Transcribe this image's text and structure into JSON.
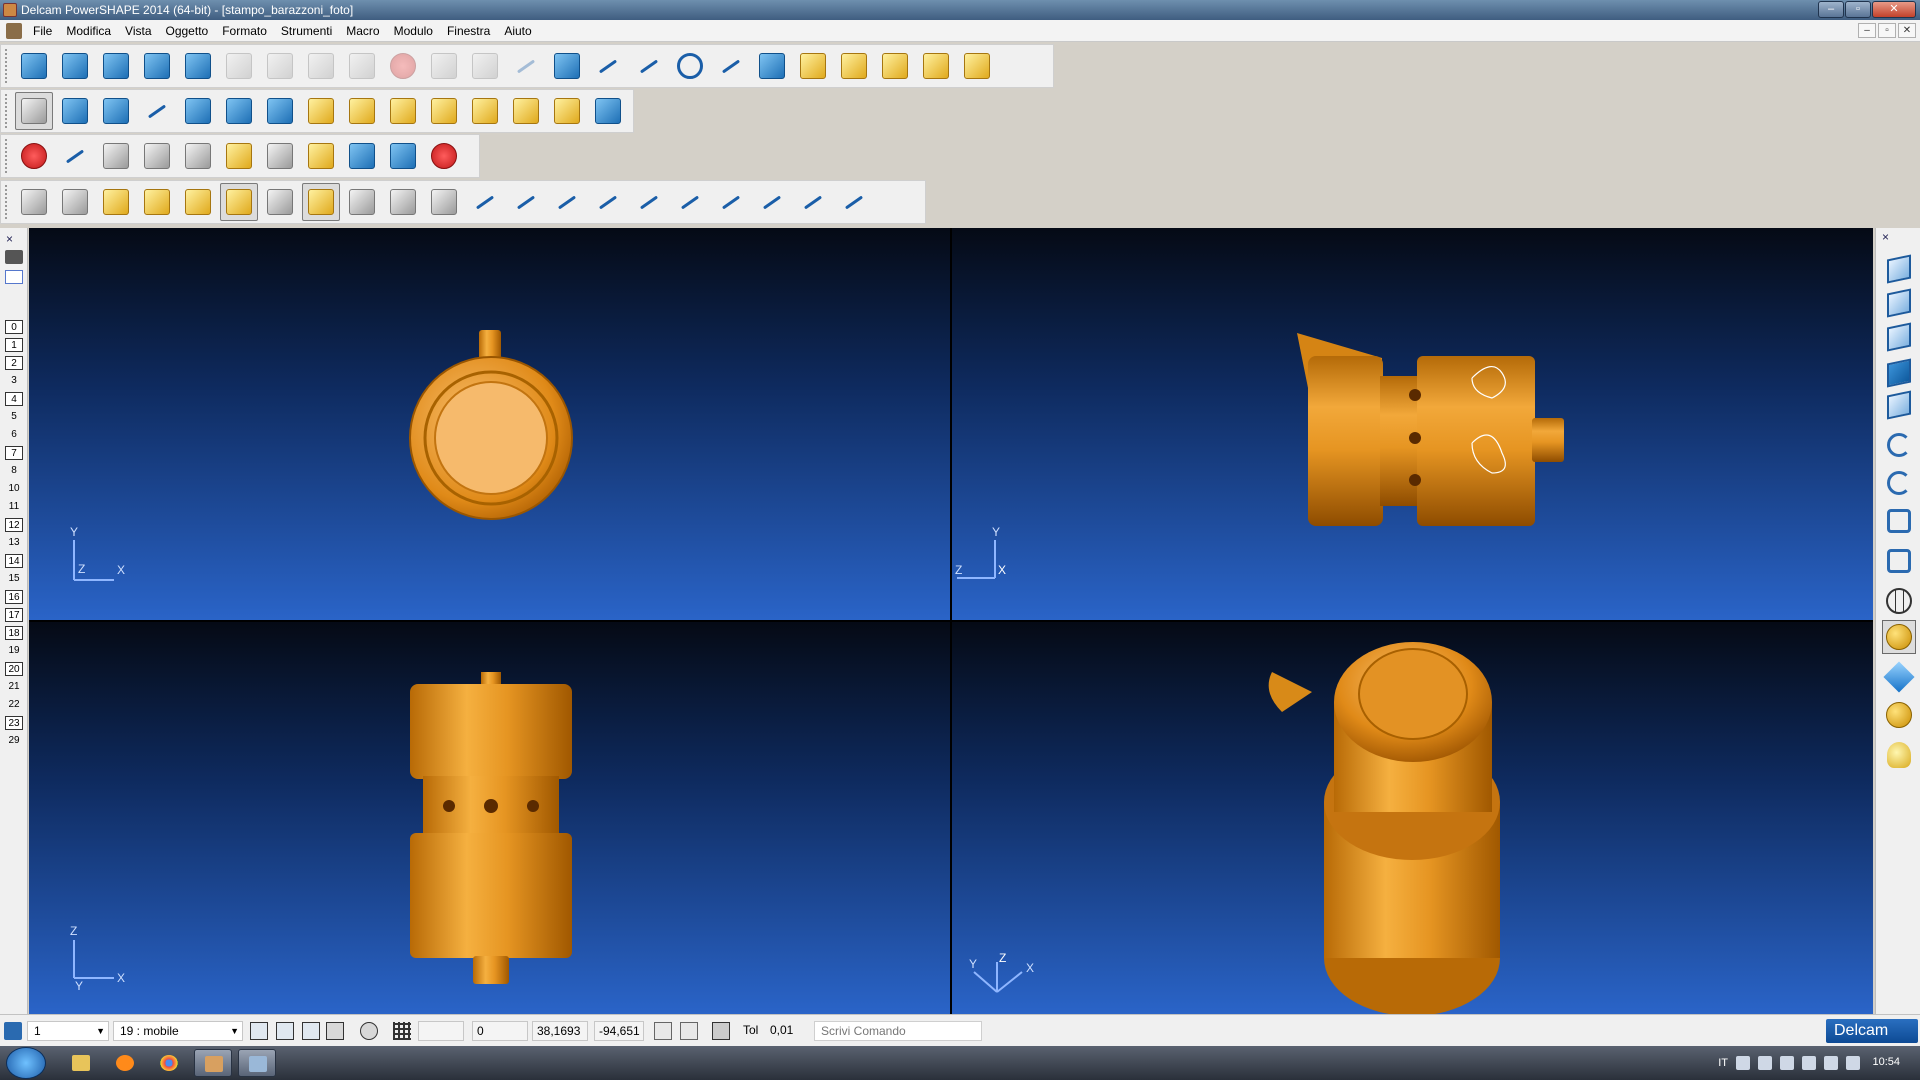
{
  "window": {
    "title": "Delcam PowerSHAPE 2014 (64-bit) - [stampo_barazzoni_foto]",
    "buttons": [
      "–",
      "▫",
      "✕"
    ]
  },
  "menu": {
    "items": [
      "File",
      "Modifica",
      "Vista",
      "Oggetto",
      "Formato",
      "Strumenti",
      "Macro",
      "Modulo",
      "Finestra",
      "Aiuto"
    ],
    "mdi_buttons": [
      "–",
      "▫",
      "✕"
    ]
  },
  "toolbar1": {
    "icons": [
      "new-file-icon",
      "open-folder-icon",
      "import-icon",
      "save-icon",
      "print-icon",
      "cut-icon",
      "copy-icon",
      "paste-icon",
      "edit-icon",
      "delete-icon",
      "undo-icon",
      "redo-icon",
      "line-edit-icon",
      "workplane-icon",
      "axis-icon",
      "line-icon",
      "circle-icon",
      "curve-icon",
      "text-icon",
      "surface-icon",
      "solid-icon",
      "model-icon",
      "settings-icon",
      "wizard-icon"
    ],
    "disabled": [
      "cut-icon",
      "copy-icon",
      "paste-icon",
      "edit-icon",
      "delete-icon",
      "undo-icon",
      "redo-icon",
      "line-edit-icon"
    ]
  },
  "toolbar2": {
    "icons": [
      "select-arrow-icon",
      "transform-icon",
      "point-icon",
      "arc-icon",
      "dimension-icon",
      "move-icon",
      "rotate-icon",
      "box-icon",
      "cube-icon",
      "boxes-icon",
      "group-icon",
      "smooth-icon",
      "grid-icon",
      "sphere-icon",
      "pyramid-icon"
    ]
  },
  "toolbar3": {
    "icons": [
      "warning-icon",
      "curve-tool-icon",
      "split-icon",
      "merge-icon",
      "trim-icon",
      "magic-icon",
      "fan-icon",
      "blocks-icon",
      "analyze-icon",
      "extrude-icon",
      "health-icon"
    ]
  },
  "toolbar4": {
    "icons": [
      "fillet-icon",
      "cylinder-icon",
      "surface-a-icon",
      "surface-b-icon",
      "surface-c-icon",
      "surface-d-icon",
      "wave-icon",
      "tube-icon",
      "extend-icon",
      "sweep-icon",
      "loft-icon",
      "curve-a-icon",
      "curve-b-icon",
      "curve-c-icon",
      "curve-d-icon",
      "curve-e-icon",
      "curve-f-icon",
      "curve-g-icon",
      "curve-h-icon",
      "curve-i-icon",
      "curve-j-icon"
    ]
  },
  "left_panel": {
    "close": "×",
    "levels": [
      {
        "label": "0",
        "on": true
      },
      {
        "label": "1",
        "on": true
      },
      {
        "label": "2",
        "on": true
      },
      {
        "label": "3",
        "on": false
      },
      {
        "label": "4",
        "on": true
      },
      {
        "label": "5",
        "on": false
      },
      {
        "label": "6",
        "on": false
      },
      {
        "label": "7",
        "on": true
      },
      {
        "label": "8",
        "on": false
      },
      {
        "label": "10",
        "on": false
      },
      {
        "label": "11",
        "on": false
      },
      {
        "label": "12",
        "on": true
      },
      {
        "label": "13",
        "on": false
      },
      {
        "label": "14",
        "on": true
      },
      {
        "label": "15",
        "on": false
      },
      {
        "label": "16",
        "on": true
      },
      {
        "label": "17",
        "on": true
      },
      {
        "label": "18",
        "on": true
      },
      {
        "label": "19",
        "on": false
      },
      {
        "label": "20",
        "on": true
      },
      {
        "label": "21",
        "on": false
      },
      {
        "label": "22",
        "on": false
      },
      {
        "label": "23",
        "on": true
      },
      {
        "label": "29",
        "on": false
      }
    ]
  },
  "views": {
    "front": {
      "axes": [
        "Y",
        "Z",
        "X"
      ]
    },
    "side": {
      "axes": [
        "Y",
        "Z",
        "X"
      ]
    },
    "top": {
      "axes": [
        "Z",
        "Y",
        "X"
      ]
    },
    "iso": {
      "axes": [
        "Y",
        "Z",
        "X"
      ]
    }
  },
  "right_panel": {
    "close": "×",
    "icons": [
      "view-front-icon",
      "view-side-icon",
      "view-top-icon",
      "view-iso-icon",
      "view-pan-icon",
      "undo-view-icon",
      "rotate-view-icon",
      "zoom-fit-icon",
      "zoom-box-icon",
      "wireframe-icon",
      "shaded-icon",
      "diamond-icon",
      "render-icon",
      "lights-icon"
    ]
  },
  "status": {
    "workplane": "1",
    "level": "19 : mobile",
    "field_a": "0",
    "x": "38,1693",
    "y": "-94,651",
    "tol_label": "Tol",
    "tol": "0,01",
    "command_placeholder": "Scrivi Comando",
    "brand": "Delcam"
  },
  "taskbar": {
    "clock": "10:54",
    "lang": "IT"
  }
}
